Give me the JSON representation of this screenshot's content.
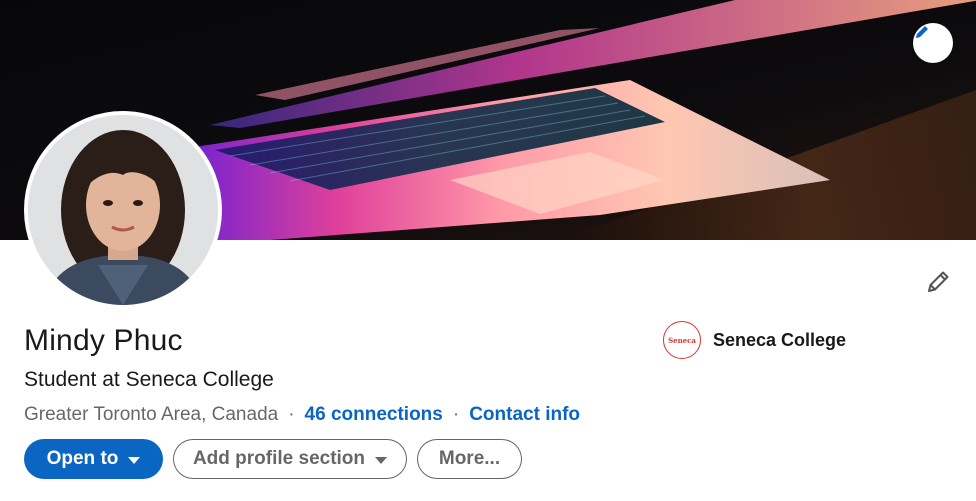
{
  "profile": {
    "name": "Mindy Phuc",
    "headline": "Student at Seneca College",
    "location": "Greater Toronto Area, Canada",
    "connections": "46 connections",
    "contact_info": "Contact info",
    "separator": "·"
  },
  "education": {
    "logo_text": "Seneca",
    "name": "Seneca College"
  },
  "actions": {
    "open_to": "Open to",
    "add_profile_section": "Add profile section",
    "more": "More..."
  },
  "icons": {
    "banner_edit": "pencil-icon",
    "intro_edit": "pencil-outline-icon",
    "dropdown": "caret-down-icon"
  },
  "colors": {
    "brand_blue": "#0a66c2",
    "seneca_red": "#d9342b",
    "muted_text": "#666666"
  }
}
